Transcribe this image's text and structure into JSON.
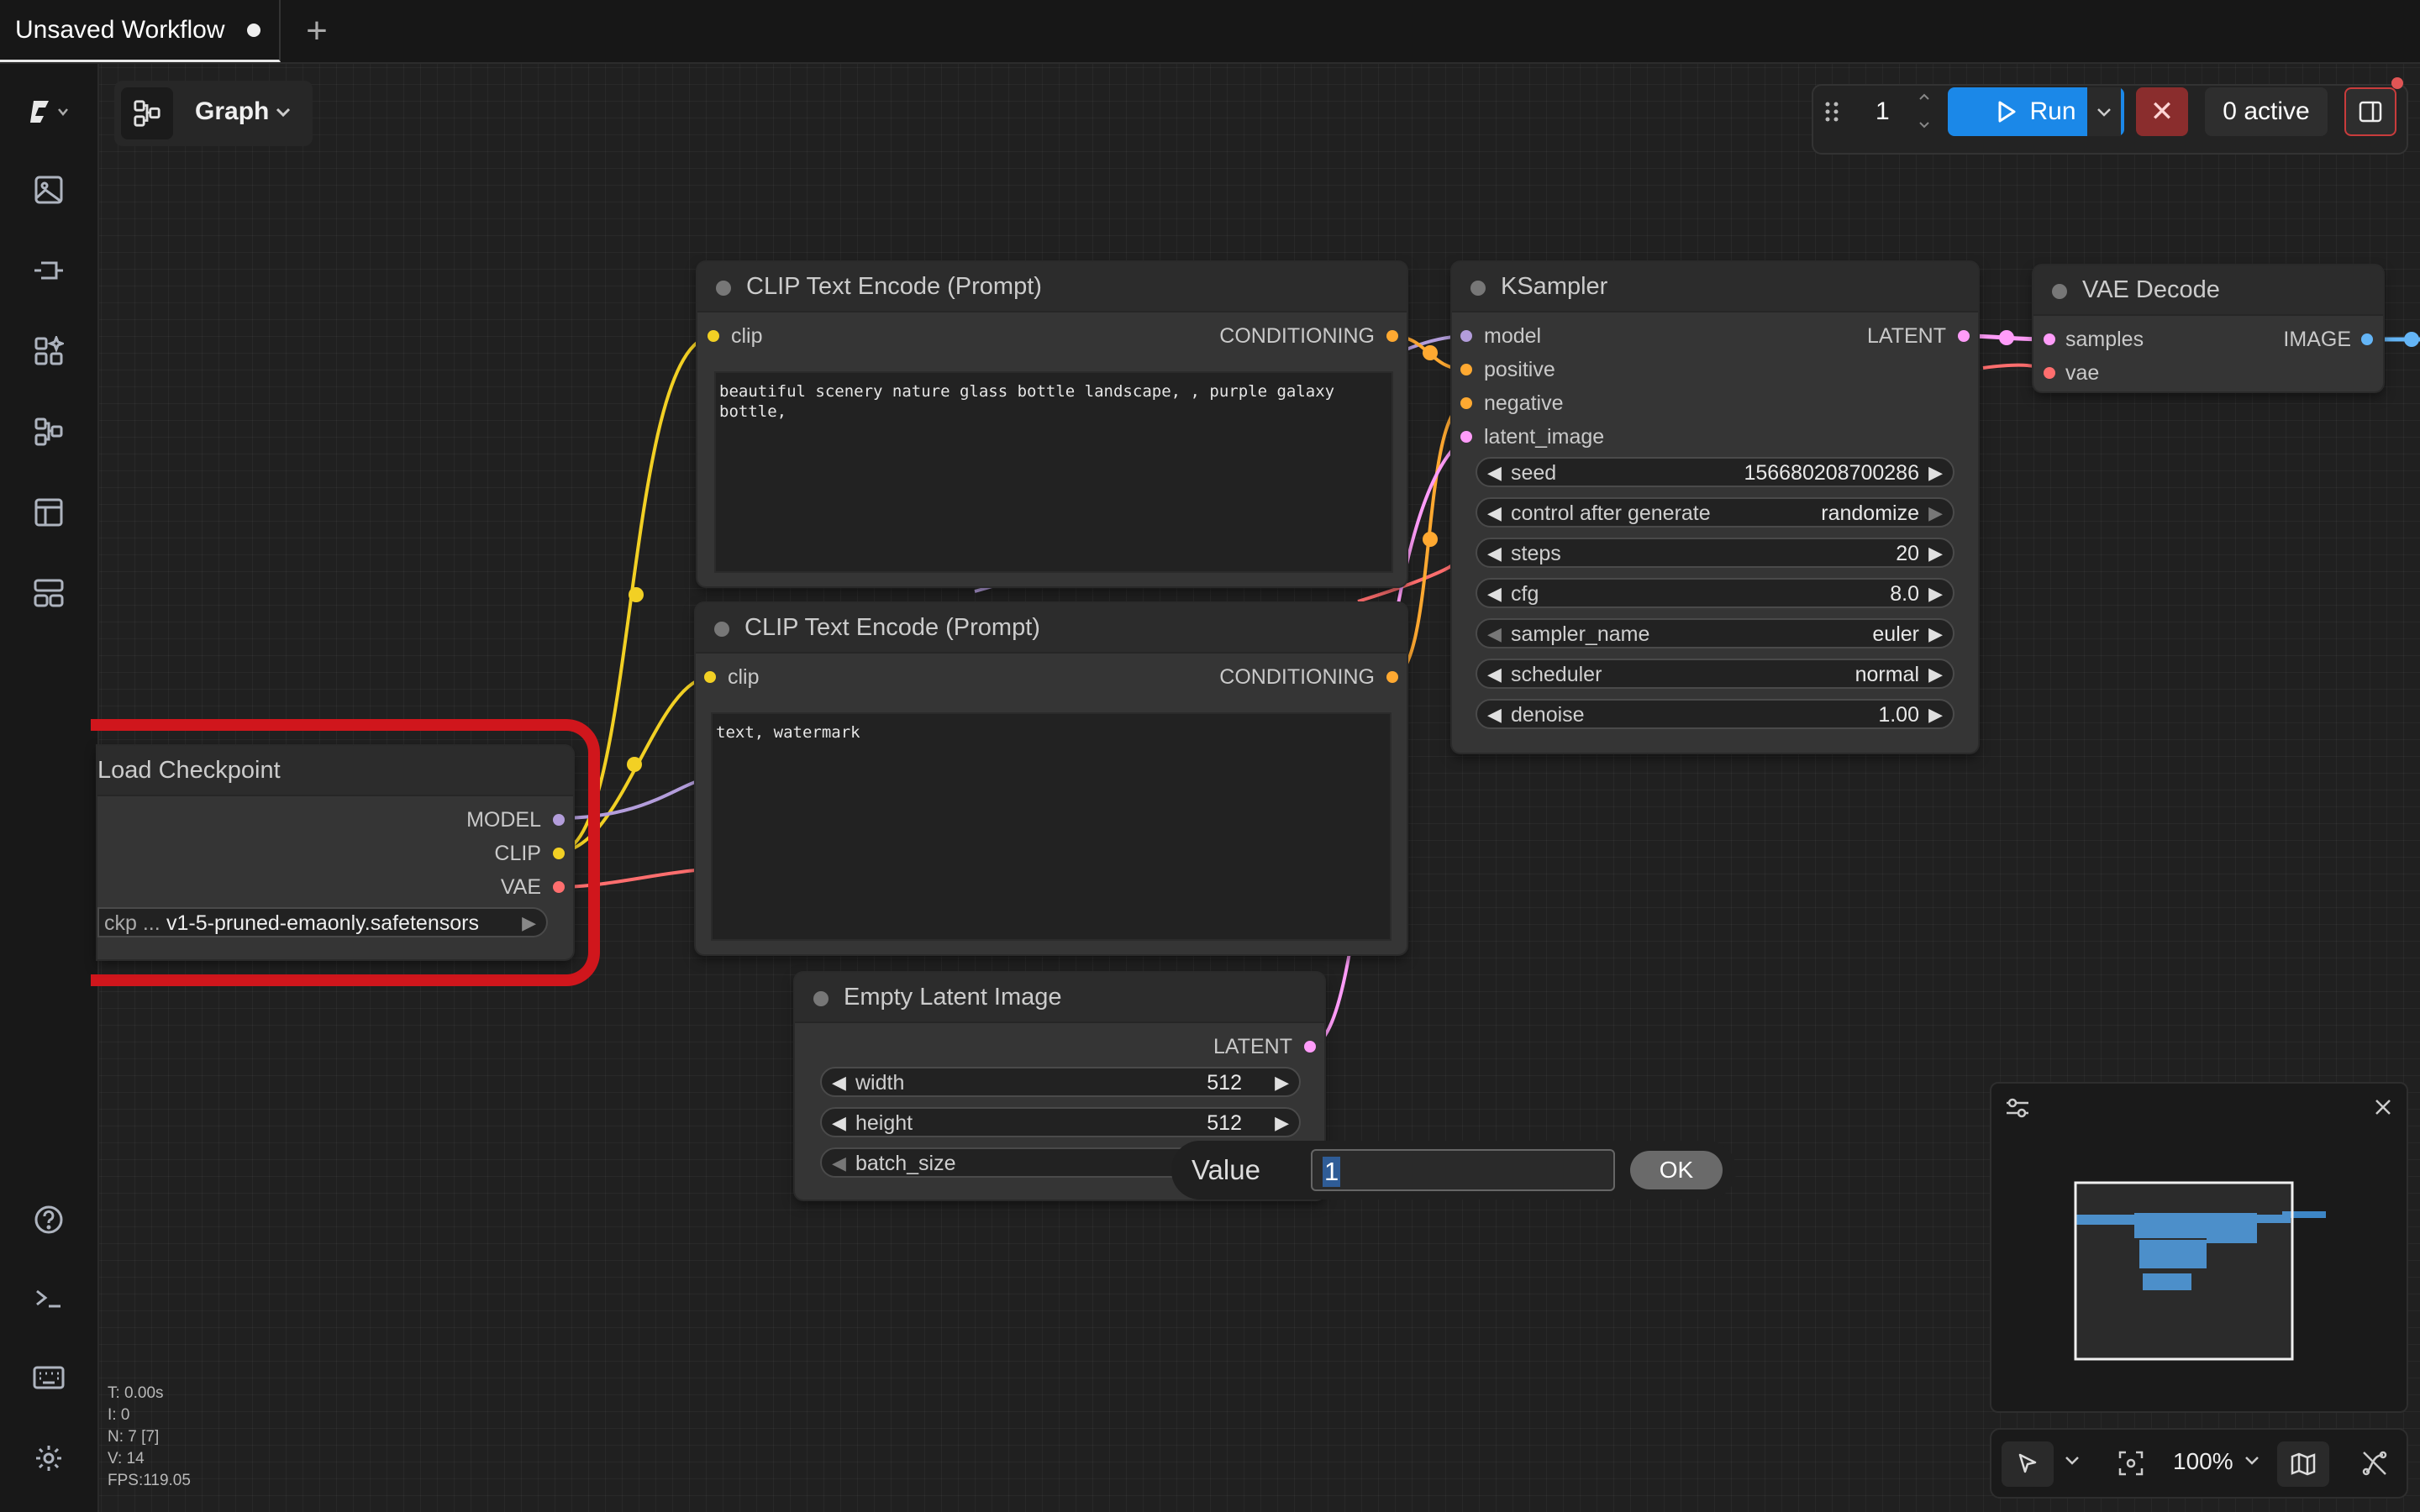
{
  "tab": {
    "title": "Unsaved Workflow",
    "plus": "+"
  },
  "graph_selector": {
    "label": "Graph"
  },
  "toolbar": {
    "batch_count": "1",
    "run_label": "Run",
    "cancel": "✕",
    "active_label": "0 active"
  },
  "nodes": {
    "clip_pos": {
      "title": "CLIP Text Encode (Prompt)",
      "input": "clip",
      "output": "CONDITIONING",
      "text": "beautiful scenery nature glass bottle landscape, , purple galaxy bottle,"
    },
    "clip_neg": {
      "title": "CLIP Text Encode (Prompt)",
      "input": "clip",
      "output": "CONDITIONING",
      "text": "text, watermark"
    },
    "ksampler": {
      "title": "KSampler",
      "inputs": [
        "model",
        "positive",
        "negative",
        "latent_image"
      ],
      "output": "LATENT",
      "widgets": [
        {
          "label": "seed",
          "value": "156680208700286"
        },
        {
          "label": "control after generate",
          "value": "randomize"
        },
        {
          "label": "steps",
          "value": "20"
        },
        {
          "label": "cfg",
          "value": "8.0"
        },
        {
          "label": "sampler_name",
          "value": "euler"
        },
        {
          "label": "scheduler",
          "value": "normal"
        },
        {
          "label": "denoise",
          "value": "1.00"
        }
      ]
    },
    "vae_decode": {
      "title": "VAE Decode",
      "inputs": [
        "samples",
        "vae"
      ],
      "output": "IMAGE"
    },
    "load_checkpoint": {
      "title": "Load Checkpoint",
      "outputs": [
        "MODEL",
        "CLIP",
        "VAE"
      ],
      "widget_label": "ckp ...",
      "widget_value": "v1-5-pruned-emaonly.safetensors"
    },
    "empty_latent": {
      "title": "Empty Latent Image",
      "output": "LATENT",
      "widgets": [
        {
          "label": "width",
          "value": "512"
        },
        {
          "label": "height",
          "value": "512"
        },
        {
          "label": "batch_size",
          "value": ""
        }
      ]
    }
  },
  "value_prompt": {
    "label": "Value",
    "input_value": "1",
    "ok_label": "OK"
  },
  "stats": {
    "t": "T: 0.00s",
    "i": "I: 0",
    "n": "N: 7 [7]",
    "v": "V: 14",
    "fps": "FPS:119.05"
  },
  "bottom_bar": {
    "zoom": "100%"
  },
  "colors": {
    "clip": "#f2d024",
    "model": "#b39ddb",
    "vae": "#ff6e6e",
    "conditioning": "#ffa931",
    "latent": "#ff9cf9",
    "image": "#64b5f6",
    "run": "#1b88e8",
    "selection": "#d0161c"
  }
}
